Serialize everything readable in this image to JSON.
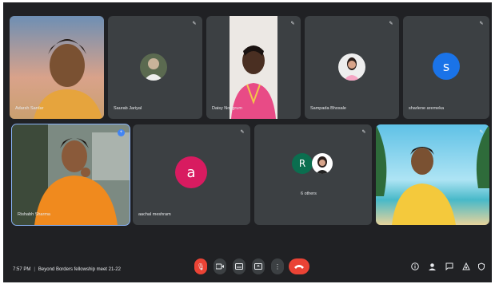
{
  "participants": [
    {
      "name": "Adarsh Sardar"
    },
    {
      "name": "Saurab Jariyal"
    },
    {
      "name": "Daisy Nongrum"
    },
    {
      "name": "Sampada Bhosale"
    },
    {
      "name": "sharlene aremeka",
      "initial": "s"
    },
    {
      "name": "Rishabh Sharma"
    },
    {
      "name": "aachal meshram",
      "initial": "a"
    },
    {
      "name": "6 others",
      "initial": "R"
    },
    {
      "name": ""
    }
  ],
  "footer": {
    "time": "7:57 PM",
    "meeting_title": "Beyond Borders fellowship meet 21-22"
  },
  "colors": {
    "tile_bg": "#3c4043",
    "meeting_bg": "#202124",
    "hang_up": "#ea4335",
    "avatar_s": "#1a73e8",
    "avatar_a": "#d81b60",
    "avatar_r": "#0b6e4f",
    "active_border": "#8ab4f8"
  },
  "controls": [
    "mic-off-icon",
    "camera-icon",
    "captions-icon",
    "present-icon",
    "more-icon",
    "hang-up-icon"
  ],
  "right_icons": [
    "info-icon",
    "people-icon",
    "chat-icon",
    "activities-icon",
    "host-controls-icon"
  ]
}
